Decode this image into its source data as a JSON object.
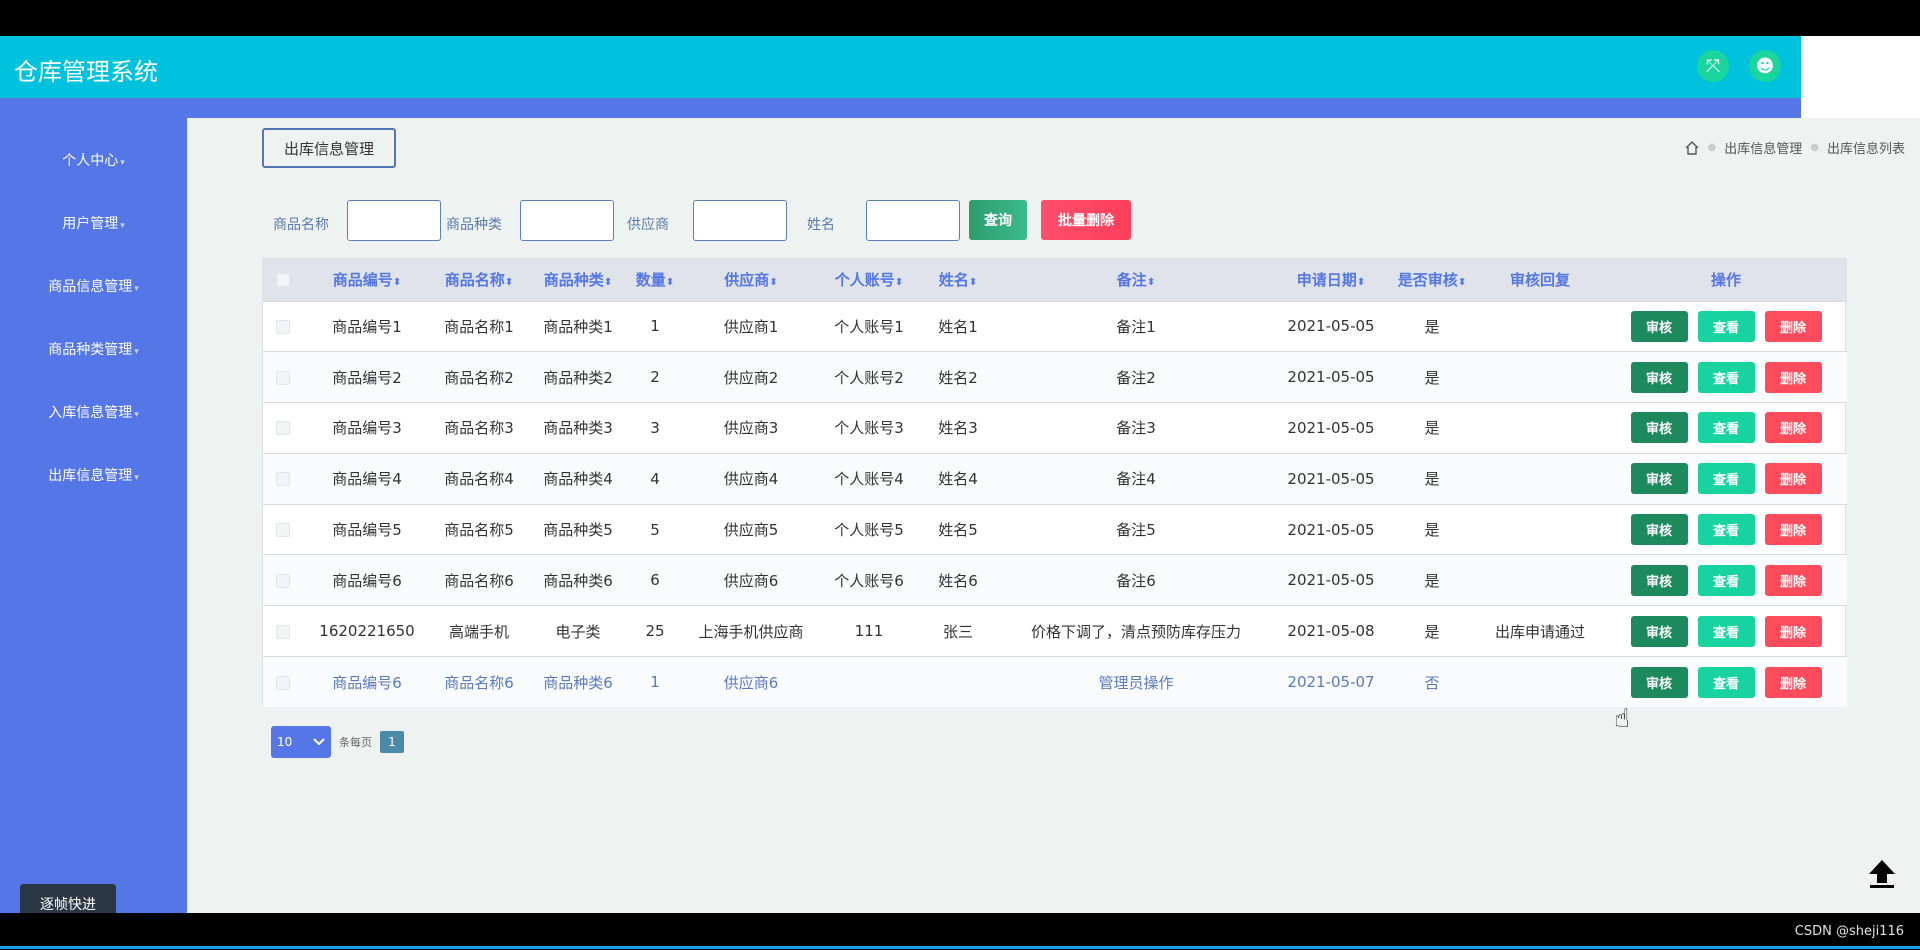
{
  "app": {
    "title": "仓库管理系统",
    "header_buttons": [
      {
        "icon": "fullscreen-icon",
        "glyph": "⤧"
      },
      {
        "icon": "user-icon",
        "glyph": "☻"
      }
    ]
  },
  "sidebar": {
    "items": [
      {
        "label": "个人中心",
        "caret": "▾"
      },
      {
        "label": "用户管理",
        "caret": "▾"
      },
      {
        "label": "商品信息管理",
        "caret": "▾"
      },
      {
        "label": "商品种类管理",
        "caret": "▾"
      },
      {
        "label": "入库信息管理",
        "caret": "▾"
      },
      {
        "label": "出库信息管理",
        "caret": "▾"
      }
    ]
  },
  "page": {
    "tab_label": "出库信息管理",
    "breadcrumb": [
      "出库信息管理",
      "出库信息列表"
    ]
  },
  "search": {
    "labels": [
      "商品名称",
      "商品种类",
      "供应商",
      "姓名"
    ],
    "query_label": "查询",
    "batch_delete_label": "批量删除"
  },
  "table": {
    "columns": [
      "商品编号",
      "商品名称",
      "商品种类",
      "数量",
      "供应商",
      "个人账号",
      "姓名",
      "备注",
      "申请日期",
      "是否审核",
      "审核回复",
      "操作"
    ],
    "sort_glyph": "⬍",
    "actions": {
      "audit": "审核",
      "view": "查看",
      "delete": "删除"
    },
    "rows": [
      {
        "code": "商品编号1",
        "name": "商品名称1",
        "type": "商品种类1",
        "qty": "1",
        "supplier": "供应商1",
        "account": "个人账号1",
        "person": "姓名1",
        "note": "备注1",
        "date": "2021-05-05",
        "audited": "是",
        "reply": ""
      },
      {
        "code": "商品编号2",
        "name": "商品名称2",
        "type": "商品种类2",
        "qty": "2",
        "supplier": "供应商2",
        "account": "个人账号2",
        "person": "姓名2",
        "note": "备注2",
        "date": "2021-05-05",
        "audited": "是",
        "reply": ""
      },
      {
        "code": "商品编号3",
        "name": "商品名称3",
        "type": "商品种类3",
        "qty": "3",
        "supplier": "供应商3",
        "account": "个人账号3",
        "person": "姓名3",
        "note": "备注3",
        "date": "2021-05-05",
        "audited": "是",
        "reply": ""
      },
      {
        "code": "商品编号4",
        "name": "商品名称4",
        "type": "商品种类4",
        "qty": "4",
        "supplier": "供应商4",
        "account": "个人账号4",
        "person": "姓名4",
        "note": "备注4",
        "date": "2021-05-05",
        "audited": "是",
        "reply": ""
      },
      {
        "code": "商品编号5",
        "name": "商品名称5",
        "type": "商品种类5",
        "qty": "5",
        "supplier": "供应商5",
        "account": "个人账号5",
        "person": "姓名5",
        "note": "备注5",
        "date": "2021-05-05",
        "audited": "是",
        "reply": ""
      },
      {
        "code": "商品编号6",
        "name": "商品名称6",
        "type": "商品种类6",
        "qty": "6",
        "supplier": "供应商6",
        "account": "个人账号6",
        "person": "姓名6",
        "note": "备注6",
        "date": "2021-05-05",
        "audited": "是",
        "reply": ""
      },
      {
        "code": "1620221650",
        "name": "高端手机",
        "type": "电子类",
        "qty": "25",
        "supplier": "上海手机供应商",
        "account": "111",
        "person": "张三",
        "note": "价格下调了，清点预防库存压力",
        "date": "2021-05-08",
        "audited": "是",
        "reply": "出库申请通过"
      },
      {
        "code": "商品编号6",
        "name": "商品名称6",
        "type": "商品种类6",
        "qty": "1",
        "supplier": "供应商6",
        "account": "",
        "person": "",
        "note": "管理员操作",
        "date": "2021-05-07",
        "audited": "否",
        "reply": ""
      }
    ]
  },
  "pager": {
    "page_size": "10",
    "page_size_label": "条每页",
    "current_page": "1"
  },
  "overlay": {
    "fast_button": "逐帧快进",
    "watermark": "CSDN @sheji116"
  },
  "colors": {
    "header": "#00c2dc",
    "sidebar": "#5476e6",
    "audit": "#1c8a5c",
    "view": "#17d3a0",
    "delete": "#ff4c5c"
  }
}
